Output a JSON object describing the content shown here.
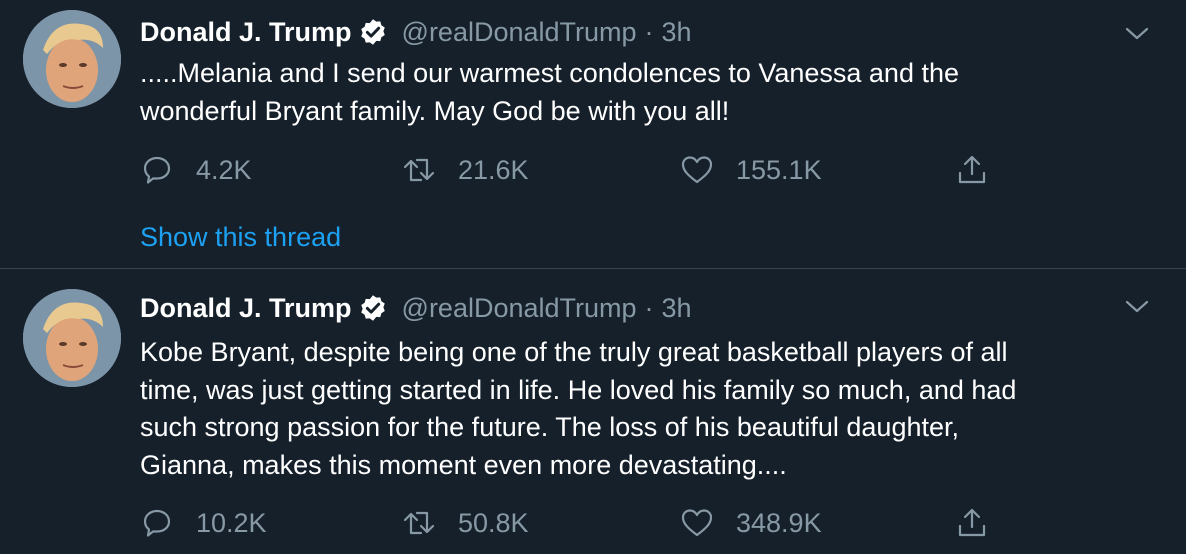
{
  "tweets": [
    {
      "author_name": "Donald J. Trump",
      "handle": "@realDonaldTrump",
      "separator": "·",
      "time": "3h",
      "text": ".....Melania and I send our warmest condolences to Vanessa and the\nwonderful Bryant family. May God be with you all!",
      "replies": "4.2K",
      "retweets": "21.6K",
      "likes": "155.1K",
      "show_thread_label": "Show this thread"
    },
    {
      "author_name": "Donald J. Trump",
      "handle": "@realDonaldTrump",
      "separator": "·",
      "time": "3h",
      "text": "Kobe Bryant, despite being one of the truly great basketball players of all\ntime, was just getting started in life. He loved his family so much, and had\nsuch strong passion for the future. The loss of his beautiful daughter,\nGianna, makes this moment even more devastating....",
      "replies": "10.2K",
      "retweets": "50.8K",
      "likes": "348.9K"
    }
  ],
  "icons": {
    "verified": "verified-badge-icon",
    "caret": "chevron-down-icon",
    "reply": "comment-bubble-icon",
    "retweet": "retweet-icon",
    "like": "heart-icon",
    "share": "share-upload-icon"
  },
  "colors": {
    "background": "#15202b",
    "divider": "#38444d",
    "primary_text": "#ffffff",
    "secondary_text": "#8899a6",
    "link": "#1da1f2"
  }
}
